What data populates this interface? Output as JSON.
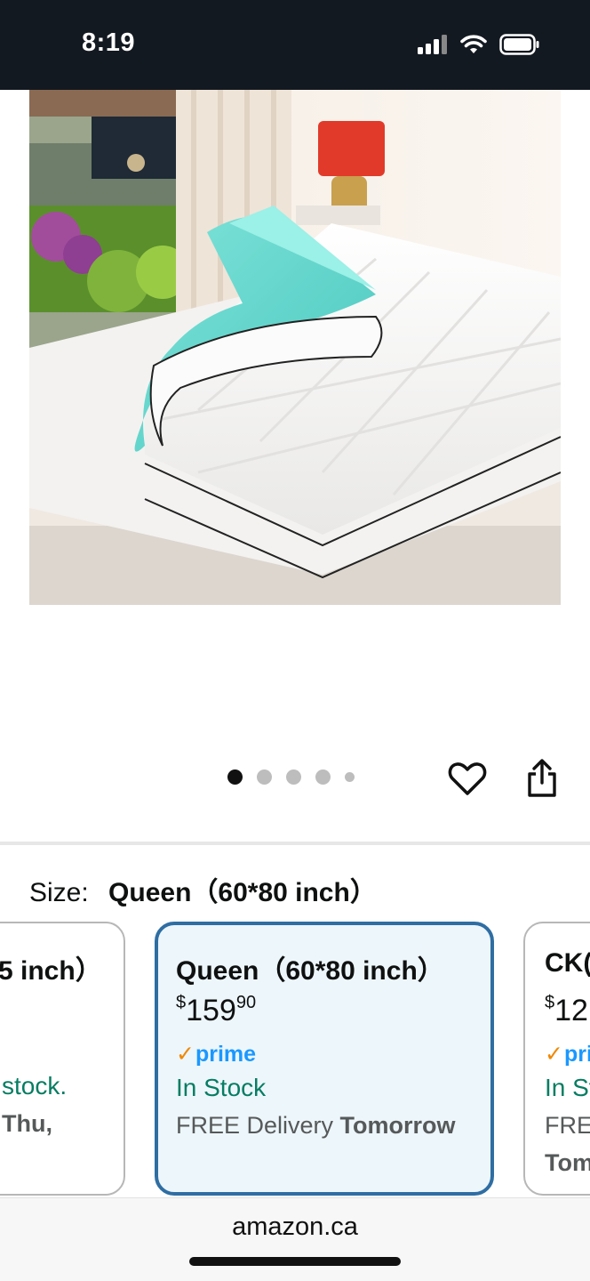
{
  "status_bar": {
    "time": "8:19"
  },
  "carousel": {
    "dot_count": 5,
    "active_index": 0
  },
  "size": {
    "label": "Size:",
    "selected_value": "Queen（60*80 inch）"
  },
  "cards": {
    "left": {
      "title": "5 inch）",
      "stock": "stock.",
      "delivery": "Thu,"
    },
    "middle": {
      "title": "Queen（60*80 inch）",
      "price_symbol": "$",
      "price_whole": "159",
      "price_fraction": "90",
      "prime_check": "✓",
      "prime": "prime",
      "stock": "In Stock",
      "delivery_prefix": "FREE Delivery ",
      "delivery_day": "Tomorrow"
    },
    "right": {
      "title": "CK(",
      "price_symbol": "$",
      "price_whole": "12",
      "prime_check": "✓",
      "prime": "pri",
      "stock": "In St",
      "delivery_prefix": "FREE",
      "delivery_day": "Tom"
    }
  },
  "browser": {
    "url": "amazon.ca"
  },
  "colors": {
    "status_bar": "#131921",
    "in_stock": "#067d62",
    "prime_blue": "#1a98ff",
    "prime_check": "#f08804",
    "selected_border": "#2f6ea3",
    "selected_bg": "#edf6fb"
  }
}
